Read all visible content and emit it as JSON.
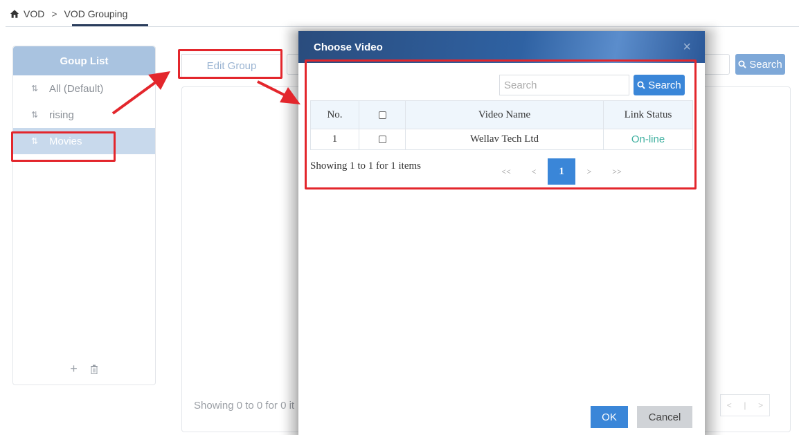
{
  "breadcrumb": {
    "home": "VOD",
    "separator": ">",
    "current": "VOD Grouping"
  },
  "sidebar": {
    "title": "Goup List",
    "items": [
      {
        "label": "All (Default)",
        "selected": false
      },
      {
        "label": "rising",
        "selected": false
      },
      {
        "label": "Movies",
        "selected": true
      }
    ],
    "add_icon": "plus-icon",
    "delete_icon": "trash-icon"
  },
  "main": {
    "edit_group_label": "Edit Group",
    "search_label": "Search",
    "showing_text": "Showing 0 to 0 for 0 it"
  },
  "modal": {
    "title": "Choose Video",
    "close_glyph": "×",
    "search_placeholder": "Search",
    "search_button": "Search",
    "table": {
      "headers": [
        "No.",
        "",
        "Video Name",
        "Link Status"
      ],
      "rows": [
        {
          "no": "1",
          "name": "Wellav Tech Ltd",
          "status": "On-line"
        }
      ]
    },
    "showing_text": "Showing 1 to 1 for 1 items",
    "pager": {
      "first": "<<",
      "prev": "<",
      "current": "1",
      "next": ">",
      "last": ">>"
    },
    "ok_label": "OK",
    "cancel_label": "Cancel"
  },
  "colors": {
    "accent": "#3a86d8",
    "header_gradient_dark": "#2a4c7d",
    "status_online": "#3fb0a0",
    "annotation_red": "#e3262c"
  }
}
